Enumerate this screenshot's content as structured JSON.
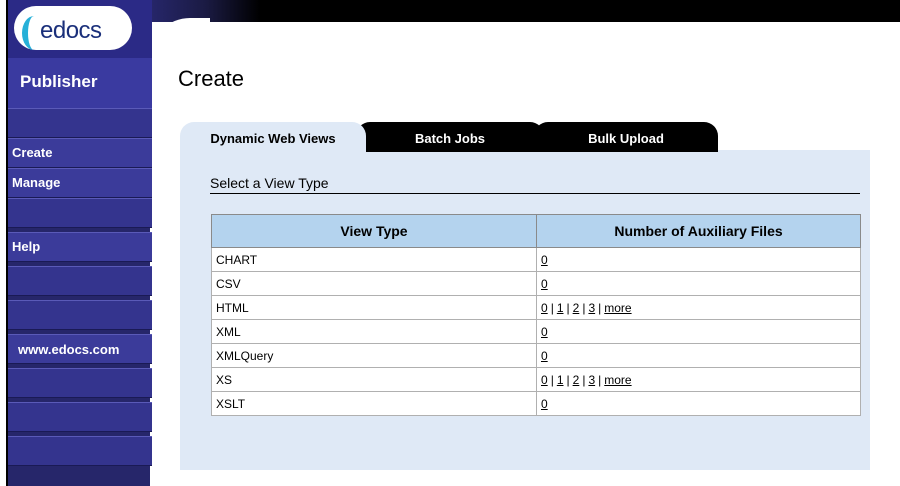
{
  "brand": {
    "logo_text": "edocs",
    "product": "Publisher",
    "site": "www.edocs.com"
  },
  "sidebar": {
    "items": [
      {
        "label": "Create"
      },
      {
        "label": "Manage"
      },
      {
        "label": "Help"
      }
    ]
  },
  "page": {
    "title": "Create"
  },
  "tabs": [
    {
      "label": "Dynamic Web Views",
      "active": true
    },
    {
      "label": "Batch Jobs",
      "active": false
    },
    {
      "label": "Bulk Upload",
      "active": false
    }
  ],
  "section": {
    "heading": "Select a View Type"
  },
  "table": {
    "headers": [
      "View Type",
      "Number of Auxiliary Files"
    ],
    "rows": [
      {
        "view_type": "CHART",
        "aux": [
          "0"
        ]
      },
      {
        "view_type": "CSV",
        "aux": [
          "0"
        ]
      },
      {
        "view_type": "HTML",
        "aux": [
          "0",
          "1",
          "2",
          "3"
        ],
        "more": "more"
      },
      {
        "view_type": "XML",
        "aux": [
          "0"
        ]
      },
      {
        "view_type": "XMLQuery",
        "aux": [
          "0"
        ]
      },
      {
        "view_type": "XS",
        "aux": [
          "0",
          "1",
          "2",
          "3"
        ],
        "more": "more"
      },
      {
        "view_type": "XSLT",
        "aux": [
          "0"
        ]
      }
    ]
  },
  "colors": {
    "sidebar": "#26266a",
    "tab_active": "#dfe9f6",
    "table_header": "#b4d3ee"
  }
}
